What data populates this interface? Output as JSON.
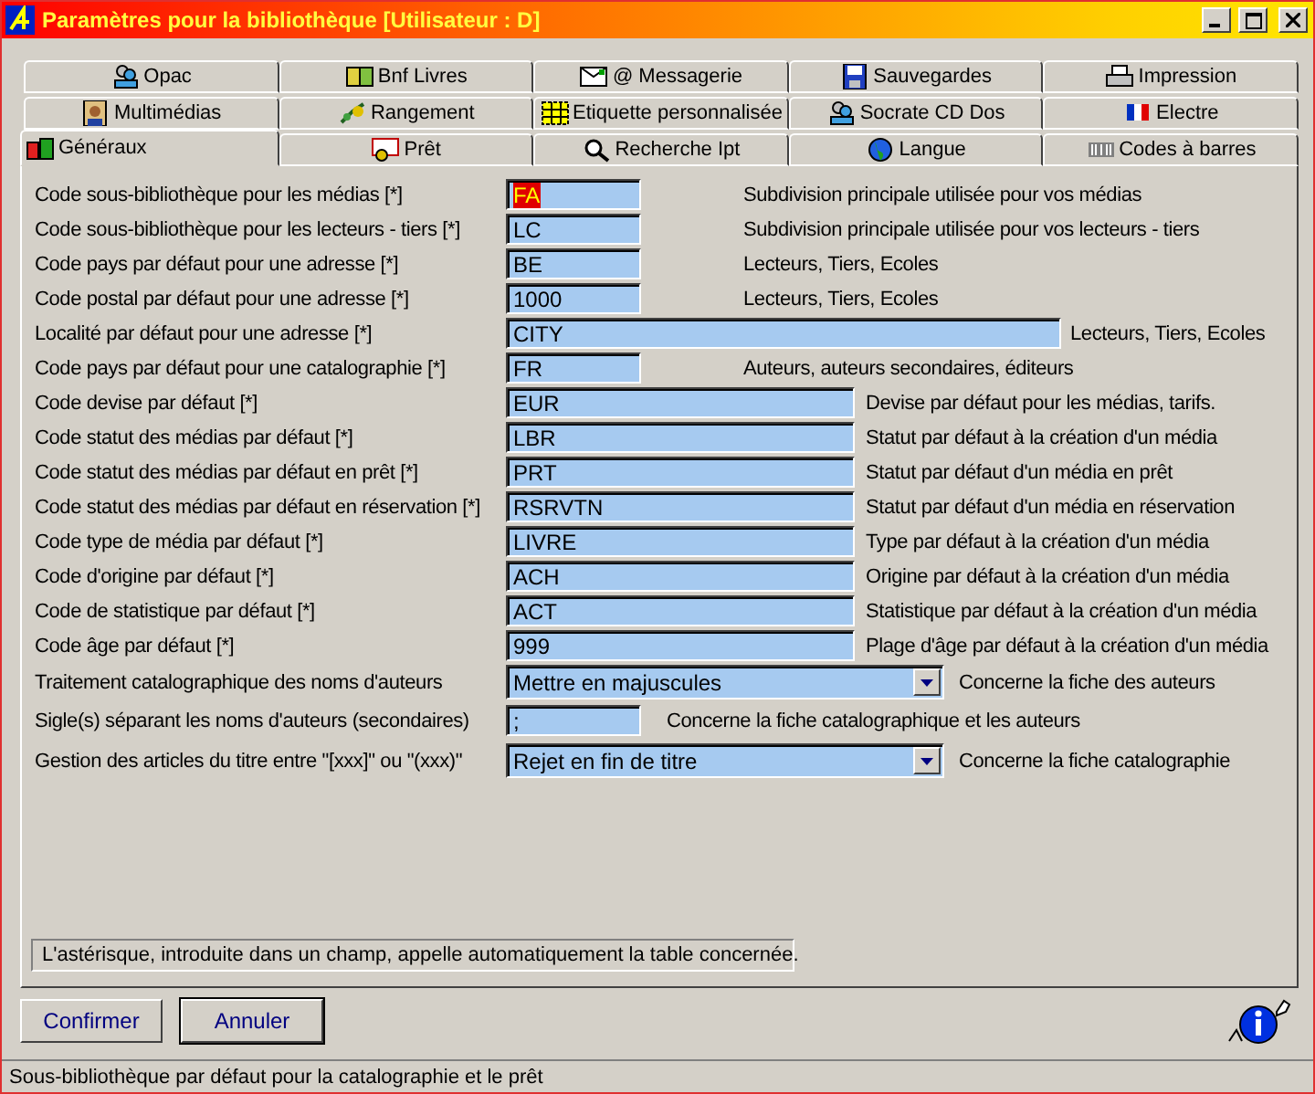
{
  "window": {
    "title": "Paramètres pour la bibliothèque [Utilisateur : D]"
  },
  "tab_rows": [
    [
      {
        "label": "Opac",
        "selected": false
      },
      {
        "label": "Bnf Livres",
        "selected": false
      },
      {
        "label": "@ Messagerie",
        "selected": false
      },
      {
        "label": "Sauvegardes",
        "selected": false
      },
      {
        "label": "Impression",
        "selected": false
      }
    ],
    [
      {
        "label": "Multimédias",
        "selected": false
      },
      {
        "label": "Rangement",
        "selected": false
      },
      {
        "label": "Etiquette personnalisée",
        "selected": false
      },
      {
        "label": "Socrate CD Dos",
        "selected": false
      },
      {
        "label": "Electre",
        "selected": false
      }
    ],
    [
      {
        "label": "Généraux",
        "selected": true
      },
      {
        "label": "Prêt",
        "selected": false
      },
      {
        "label": "Recherche Ipt",
        "selected": false
      },
      {
        "label": "Langue",
        "selected": false
      },
      {
        "label": "Codes à barres",
        "selected": false
      }
    ]
  ],
  "fields": [
    {
      "kind": "short",
      "label": "Code sous-bibliothèque pour les médias [*]",
      "value": "FA",
      "value_selected": true,
      "description": "Subdivision principale utilisée pour vos médias"
    },
    {
      "kind": "short",
      "label": "Code sous-bibliothèque pour les lecteurs - tiers [*]",
      "value": "LC",
      "value_selected": false,
      "description": "Subdivision principale utilisée pour vos lecteurs - tiers"
    },
    {
      "kind": "short",
      "label": "Code pays par défaut pour une adresse [*]",
      "value": "BE",
      "value_selected": false,
      "description": "Lecteurs, Tiers, Ecoles"
    },
    {
      "kind": "short",
      "label": "Code postal par défaut pour une adresse [*]",
      "value": "1000",
      "value_selected": false,
      "description": "Lecteurs, Tiers, Ecoles"
    },
    {
      "kind": "long",
      "label": "Localité par défaut pour une adresse [*]",
      "value": "CITY",
      "value_selected": false,
      "description": "Lecteurs, Tiers, Ecoles"
    },
    {
      "kind": "short",
      "label": "Code pays par défaut pour une catalographie [*]",
      "value": "FR",
      "value_selected": false,
      "description": "Auteurs, auteurs secondaires, éditeurs"
    },
    {
      "kind": "medium",
      "label": "Code devise par défaut [*]",
      "value": "EUR",
      "value_selected": false,
      "description": "Devise par défaut pour les médias, tarifs."
    },
    {
      "kind": "medium",
      "label": "Code statut des médias par défaut [*]",
      "value": "LBR",
      "value_selected": false,
      "description": "Statut par défaut à la création d'un média"
    },
    {
      "kind": "medium",
      "label": "Code statut des médias par défaut en prêt [*]",
      "value": "PRT",
      "value_selected": false,
      "description": "Statut par défaut d'un média en prêt"
    },
    {
      "kind": "medium",
      "label": "Code statut des médias par défaut en réservation [*]",
      "value": "RSRVTN",
      "value_selected": false,
      "description": "Statut par défaut d'un média en réservation"
    },
    {
      "kind": "medium",
      "label": "Code type de média par défaut [*]",
      "value": "LIVRE",
      "value_selected": false,
      "description": "Type par défaut à la création d'un média"
    },
    {
      "kind": "medium",
      "label": "Code d'origine par défaut [*]",
      "value": "ACH",
      "value_selected": false,
      "description": "Origine par défaut à la création d'un média"
    },
    {
      "kind": "medium",
      "label": "Code de statistique par défaut [*]",
      "value": "ACT",
      "value_selected": false,
      "description": "Statistique par défaut à la création d'un média"
    },
    {
      "kind": "medium",
      "label": "Code âge par défaut [*]",
      "value": "999",
      "value_selected": false,
      "description": "Plage d'âge par défaut à la création d'un média"
    },
    {
      "kind": "select",
      "label": "Traitement catalographique des noms d'auteurs",
      "value": "Mettre en majuscules",
      "value_selected": false,
      "description": "Concerne la fiche des auteurs"
    },
    {
      "kind": "narrow",
      "label": "Sigle(s) séparant les noms d'auteurs (secondaires)",
      "value": ";",
      "value_selected": false,
      "description": "Concerne la fiche catalographique et les auteurs"
    },
    {
      "kind": "select",
      "label": "Gestion des articles du titre entre \"[xxx]\" ou \"(xxx)\"",
      "value": "Rejet en fin de titre",
      "value_selected": false,
      "description": "Concerne la fiche catalographie"
    }
  ],
  "hint": "L'astérisque, introduite dans un champ, appelle automatiquement la table concernée.",
  "buttons": [
    {
      "label": "Confirmer",
      "default": false
    },
    {
      "label": "Annuler",
      "default": true
    }
  ],
  "status_bar": "Sous-bibliothèque par défaut pour la catalographie et le prêt"
}
